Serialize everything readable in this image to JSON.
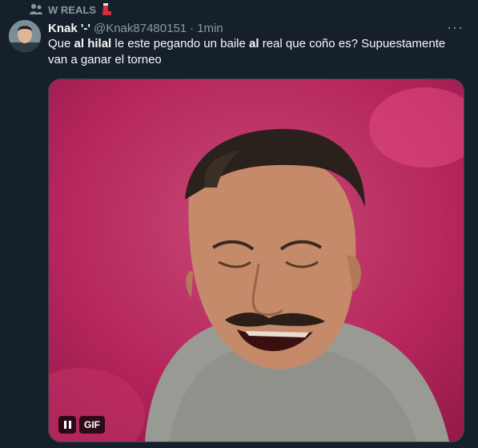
{
  "context": {
    "icon": "people-icon",
    "label": "W REALS",
    "badge_icon": "red-boot-icon"
  },
  "tweet": {
    "author_name": "Knak '-'",
    "author_handle": "@Knak87480151",
    "separator": "·",
    "time": "1min",
    "more_icon": "more-dots-icon",
    "more_glyph": "···",
    "text_parts": {
      "p1": "Que ",
      "p2": "al hilal",
      "p3": " le este pegando un baile ",
      "p4": "al",
      "p5": " real que coño es? Supuestamente van a ganar el torneo"
    },
    "media": {
      "type": "gif",
      "badge": "GIF",
      "pause_icon": "pause-icon"
    }
  },
  "colors": {
    "background": "#15202b",
    "text": "#f7f9f9",
    "secondary": "#8b98a5",
    "border": "#38444d"
  }
}
